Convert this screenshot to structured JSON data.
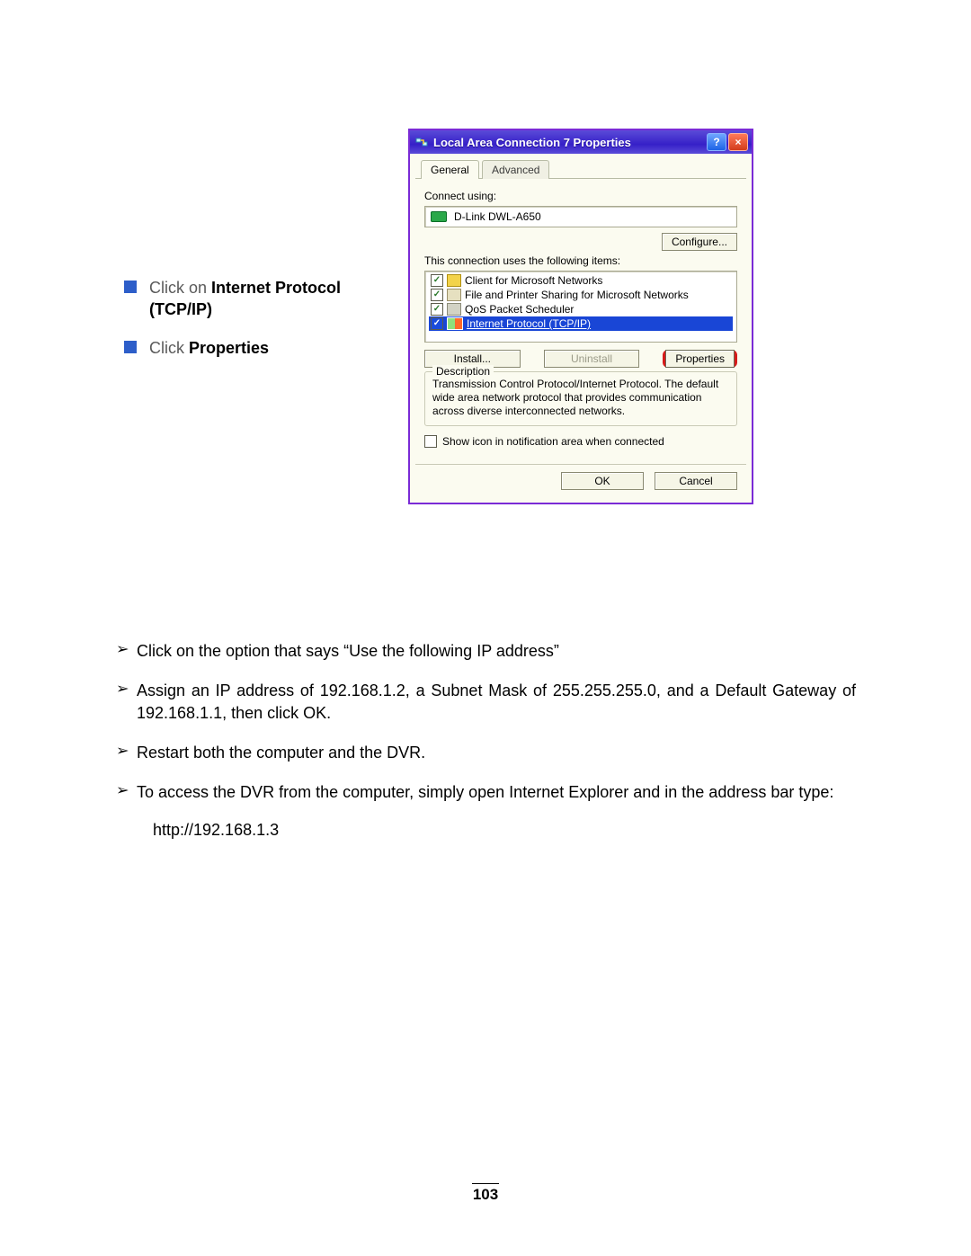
{
  "left_bullets": [
    {
      "pre": "Click on ",
      "bold": "Internet Protocol (TCP/IP)",
      "post": ""
    },
    {
      "pre": "Click ",
      "bold": "Properties",
      "post": ""
    }
  ],
  "dialog": {
    "title": "Local Area Connection 7 Properties",
    "tabs": {
      "active": "General",
      "inactive": "Advanced"
    },
    "connect_label": "Connect using:",
    "adapter": "D-Link DWL-A650",
    "configure": "Configure...",
    "items_label": "This connection uses the following items:",
    "items": [
      {
        "name": "Client for Microsoft Networks",
        "icon": "client"
      },
      {
        "name": "File and Printer Sharing for Microsoft Networks",
        "icon": "share"
      },
      {
        "name": "QoS Packet Scheduler",
        "icon": "qos"
      },
      {
        "name": "Internet Protocol (TCP/IP)",
        "icon": "tcpip",
        "selected": true
      }
    ],
    "install": "Install...",
    "uninstall": "Uninstall",
    "properties": "Properties",
    "description_label": "Description",
    "description": "Transmission Control Protocol/Internet Protocol. The default wide area network protocol that provides communication across diverse interconnected networks.",
    "showicon": "Show icon in notification area when connected",
    "ok": "OK",
    "cancel": "Cancel"
  },
  "body": [
    "Click on the option that says “Use the following IP address”",
    "Assign an IP address of 192.168.1.2, a Subnet Mask of 255.255.255.0, and a Default Gateway of 192.168.1.1, then click OK.",
    "Restart both the computer and the DVR.",
    "To access the DVR from the computer, simply open Internet Explorer and in the address bar type:"
  ],
  "url": "http://192.168.1.3",
  "page_number": "103"
}
